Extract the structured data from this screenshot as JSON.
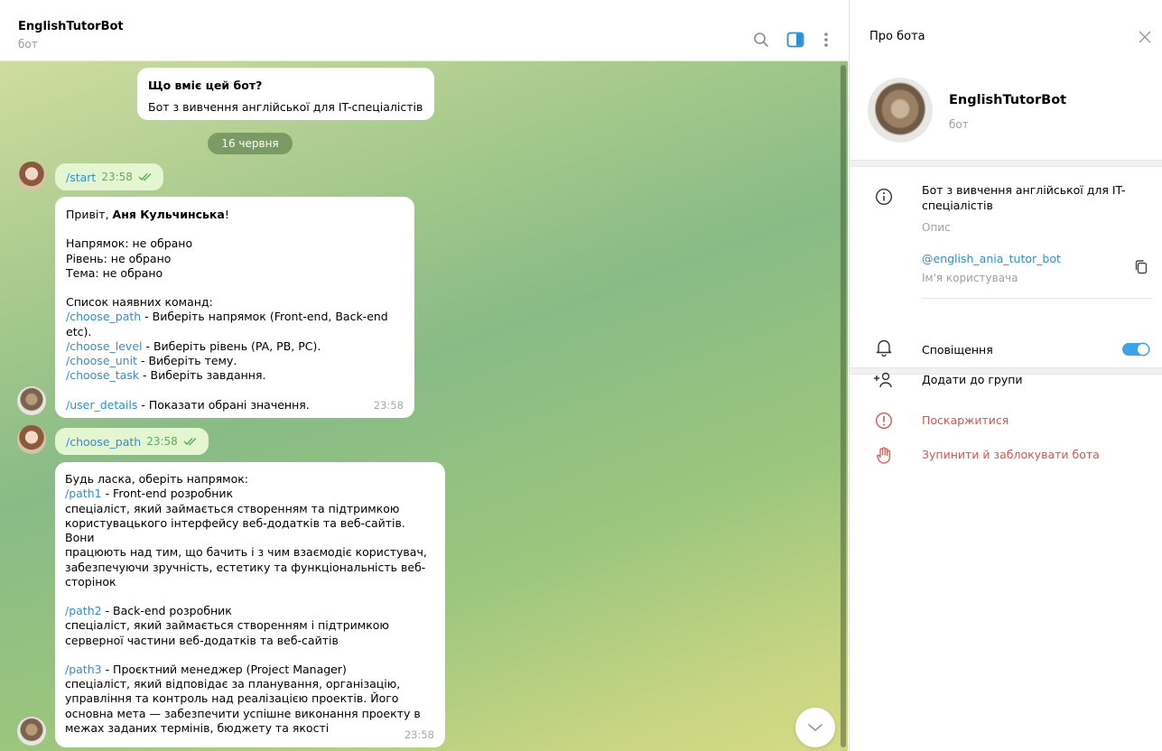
{
  "header": {
    "title": "EnglishTutorBot",
    "subtitle": "бот",
    "icons": [
      "search-icon",
      "sidebar-toggle-icon",
      "more-vertical-icon"
    ]
  },
  "chat": {
    "intro": {
      "heading": "Що вміє цей бот?",
      "text": "Бот з вивчення англійської для IT-спеціалістів"
    },
    "date_pill": "16 червня",
    "msg1": {
      "command": "/start",
      "time": "23:58"
    },
    "msg2": {
      "greeting": "Привіт, ",
      "name": "Аня Кульчинська",
      "bang": "!",
      "line1": "Напрямок: не обрано",
      "line2": "Рівень: не обрано",
      "line3": "Тема: не обрано",
      "list_title": "Список наявних команд:",
      "commands": [
        {
          "cmd": "/choose_path",
          "desc": " - Виберіть напрямок (Front-end, Back-end etc)."
        },
        {
          "cmd": "/choose_level",
          "desc": " - Виберіть рівень (PA, PB, PC)."
        },
        {
          "cmd": "/choose_unit",
          "desc": " - Виберіть тему."
        },
        {
          "cmd": "/choose_task",
          "desc": " - Виберіть завдання."
        }
      ],
      "details_cmd": "/user_details",
      "details_desc": " - Показати обрані значення.",
      "time": "23:58"
    },
    "msg3": {
      "command": "/choose_path",
      "time": "23:58"
    },
    "msg4": {
      "intro": "Будь ласка, оберіть напрямок:",
      "path1_cmd": "/path1",
      "path1_title": " - Front-end розробник",
      "path1_desc": [
        "спеціаліст, який займається створенням та підтримкою",
        "користувацького інтерфейсу веб-додатків та веб-сайтів. Вони",
        "працюють над тим, що бачить і з чим взаємодіє користувач,",
        "забезпечуючи зручність, естетику та функціональність веб-",
        "сторінок"
      ],
      "path2_cmd": "/path2",
      "path2_title": " - Back-end розробник",
      "path2_desc": [
        "спеціаліст, який займається створенням і підтримкою",
        "серверної частини веб-додатків та веб-сайтів"
      ],
      "path3_cmd": "/path3",
      "path3_title": " - Проєктний менеджер (Project Manager)",
      "path3_desc": [
        "спеціаліст, який відповідає за планування, організацію,",
        "управління та контроль над реалізацією проектів. Його",
        "основна мета — забезпечити успішне виконання проекту в",
        "межах заданих термінів, бюджету та якості"
      ],
      "time": "23:58"
    }
  },
  "panel": {
    "title": "Про бота",
    "name": "EnglishTutorBot",
    "subtitle": "бот",
    "description_line1": "Бот з вивчення англійської для IT-",
    "description_line2": "спеціалістів",
    "description_label": "Опис",
    "username": "@english_ania_tutor_bot",
    "username_label": "Ім'я користувача",
    "notifications": "Сповіщення",
    "notifications_on": true,
    "add_to_group": "Додати до групи",
    "report": "Поскаржитися",
    "block": "Зупинити й заблокувати бота"
  },
  "colors": {
    "link": "#2f8fd6",
    "danger": "#e0534f",
    "toggle": "#3ea3e6",
    "outgoing_bubble": "#e4f5d2"
  }
}
